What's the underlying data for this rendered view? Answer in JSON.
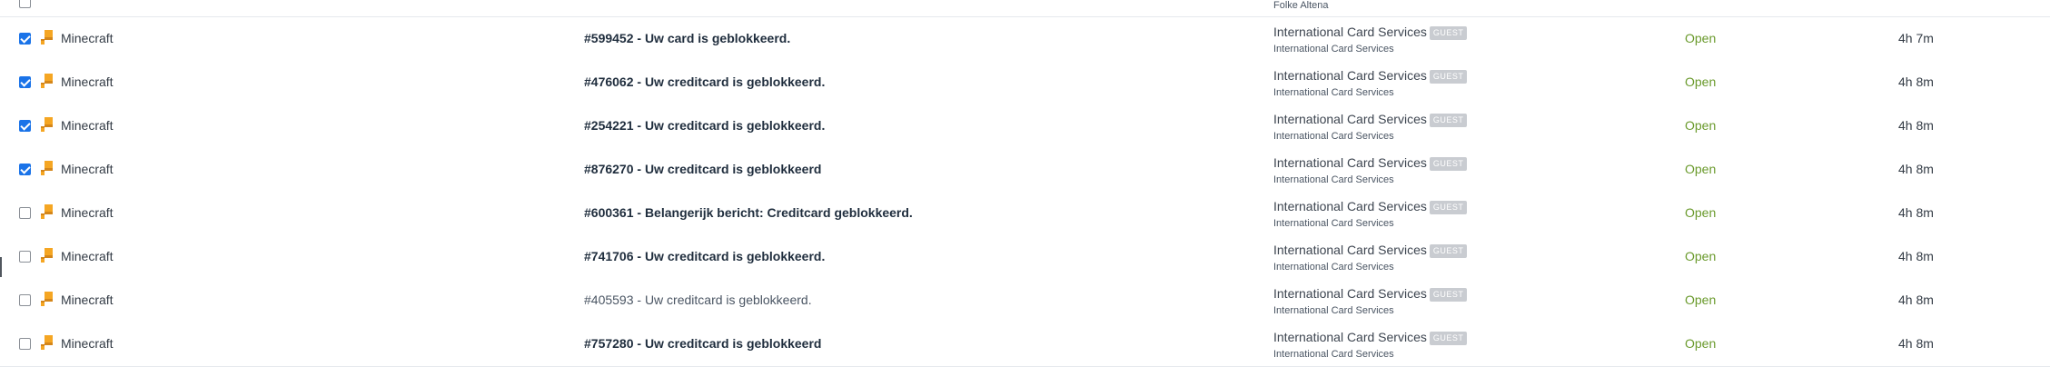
{
  "partial_row": {
    "requester_org": "Folke Altena",
    "checked": false
  },
  "colors": {
    "status_open": "#6a9a2c",
    "checkbox_checked": "#1a73e8",
    "guest_badge_bg": "#c9ccd1",
    "app_icon_primary": "#f5a623"
  },
  "rows": [
    {
      "checked": true,
      "app_icon": "minecraft-icon",
      "app": "Minecraft",
      "subject": "#599452 - Uw card is geblokkeerd.",
      "unread": true,
      "requester": "International Card Services",
      "badge": "GUEST",
      "org": "International Card Services",
      "status": "Open",
      "age": "4h 7m"
    },
    {
      "checked": true,
      "app_icon": "minecraft-icon",
      "app": "Minecraft",
      "subject": "#476062 - Uw creditcard is geblokkeerd.",
      "unread": true,
      "requester": "International Card Services",
      "badge": "GUEST",
      "org": "International Card Services",
      "status": "Open",
      "age": "4h 8m"
    },
    {
      "checked": true,
      "app_icon": "minecraft-icon",
      "app": "Minecraft",
      "subject": "#254221 - Uw creditcard is geblokkeerd.",
      "unread": true,
      "requester": "International Card Services",
      "badge": "GUEST",
      "org": "International Card Services",
      "status": "Open",
      "age": "4h 8m"
    },
    {
      "checked": true,
      "app_icon": "minecraft-icon",
      "app": "Minecraft",
      "subject": "#876270 - Uw creditcard is geblokkeerd",
      "unread": true,
      "requester": "International Card Services",
      "badge": "GUEST",
      "org": "International Card Services",
      "status": "Open",
      "age": "4h 8m"
    },
    {
      "checked": false,
      "app_icon": "minecraft-icon",
      "app": "Minecraft",
      "subject": "#600361 - Belangerijk bericht: Creditcard geblokkeerd.",
      "unread": true,
      "requester": "International Card Services",
      "badge": "GUEST",
      "org": "International Card Services",
      "status": "Open",
      "age": "4h 8m"
    },
    {
      "checked": false,
      "app_icon": "minecraft-icon",
      "app": "Minecraft",
      "subject": "#741706 - Uw creditcard is geblokkeerd.",
      "unread": true,
      "requester": "International Card Services",
      "badge": "GUEST",
      "org": "International Card Services",
      "status": "Open",
      "age": "4h 8m"
    },
    {
      "checked": false,
      "app_icon": "minecraft-icon",
      "app": "Minecraft",
      "subject": "#405593 - Uw creditcard is geblokkeerd.",
      "unread": false,
      "requester": "International Card Services",
      "badge": "GUEST",
      "org": "International Card Services",
      "status": "Open",
      "age": "4h 8m"
    },
    {
      "checked": false,
      "app_icon": "minecraft-icon",
      "app": "Minecraft",
      "subject": "#757280 - Uw creditcard is geblokkeerd",
      "unread": true,
      "requester": "International Card Services",
      "badge": "GUEST",
      "org": "International Card Services",
      "status": "Open",
      "age": "4h 8m"
    }
  ]
}
